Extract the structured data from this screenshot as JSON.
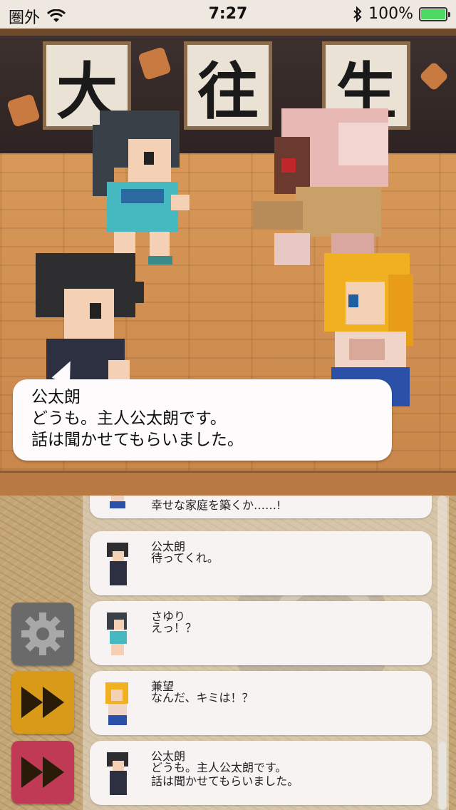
{
  "status_bar": {
    "carrier": "圏外",
    "time": "7:27",
    "battery_percent": "100%",
    "battery_level": 1.0,
    "battery_color": "#4cd964"
  },
  "scene": {
    "plaques": [
      "大",
      "往",
      "生"
    ]
  },
  "dialog": {
    "speaker": "公太朗",
    "lines": [
      "どうも。主人公太朗です。",
      "話は聞かせてもらいました。"
    ]
  },
  "log": {
    "partial_text": "幸せな家庭を築くか……!",
    "entries": [
      {
        "name": "公太朗",
        "text": "待ってくれ。",
        "avatar": "kotaro-avatar"
      },
      {
        "name": "さゆり",
        "text": "えっ！？",
        "avatar": "sayuri-avatar"
      },
      {
        "name": "兼望",
        "text": "なんだ、キミは！？",
        "avatar": "kenbo-avatar"
      },
      {
        "name": "公太朗",
        "text": "どうも。主人公太朗です。\n話は聞かせてもらいました。",
        "avatar": "kotaro-avatar"
      }
    ]
  },
  "buttons": {
    "settings_icon": "gear-icon",
    "fast_forward_icon": "fast-forward-icon",
    "skip_icon": "skip-icon",
    "colors": {
      "settings": "#6a6a6a",
      "fast_forward": "#d99a1a",
      "skip": "#c03a55"
    }
  }
}
